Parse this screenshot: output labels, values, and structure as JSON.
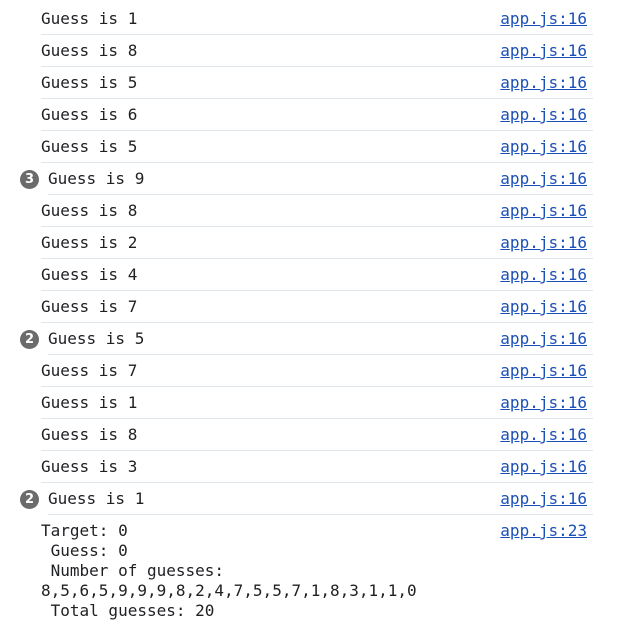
{
  "console": {
    "messages": [
      {
        "text": "Guess is 1",
        "source": "app.js:16",
        "count": ""
      },
      {
        "text": "Guess is 8",
        "source": "app.js:16",
        "count": ""
      },
      {
        "text": "Guess is 5",
        "source": "app.js:16",
        "count": ""
      },
      {
        "text": "Guess is 6",
        "source": "app.js:16",
        "count": ""
      },
      {
        "text": "Guess is 5",
        "source": "app.js:16",
        "count": ""
      },
      {
        "text": "Guess is 9",
        "source": "app.js:16",
        "count": "3"
      },
      {
        "text": "Guess is 8",
        "source": "app.js:16",
        "count": ""
      },
      {
        "text": "Guess is 2",
        "source": "app.js:16",
        "count": ""
      },
      {
        "text": "Guess is 4",
        "source": "app.js:16",
        "count": ""
      },
      {
        "text": "Guess is 7",
        "source": "app.js:16",
        "count": ""
      },
      {
        "text": "Guess is 5",
        "source": "app.js:16",
        "count": "2"
      },
      {
        "text": "Guess is 7",
        "source": "app.js:16",
        "count": ""
      },
      {
        "text": "Guess is 1",
        "source": "app.js:16",
        "count": ""
      },
      {
        "text": "Guess is 8",
        "source": "app.js:16",
        "count": ""
      },
      {
        "text": "Guess is 3",
        "source": "app.js:16",
        "count": ""
      },
      {
        "text": "Guess is 1",
        "source": "app.js:16",
        "count": "2"
      }
    ],
    "summary": {
      "text": "Target: 0\n Guess: 0\n Number of guesses:\n8,5,6,5,9,9,9,8,2,4,7,5,5,7,1,8,3,1,1,0\n Total guesses: 20",
      "source": "app.js:23"
    }
  },
  "colors": {
    "link": "#1a4fb8",
    "badge": "#6b6b6b",
    "divider": "#dfe6ed"
  }
}
